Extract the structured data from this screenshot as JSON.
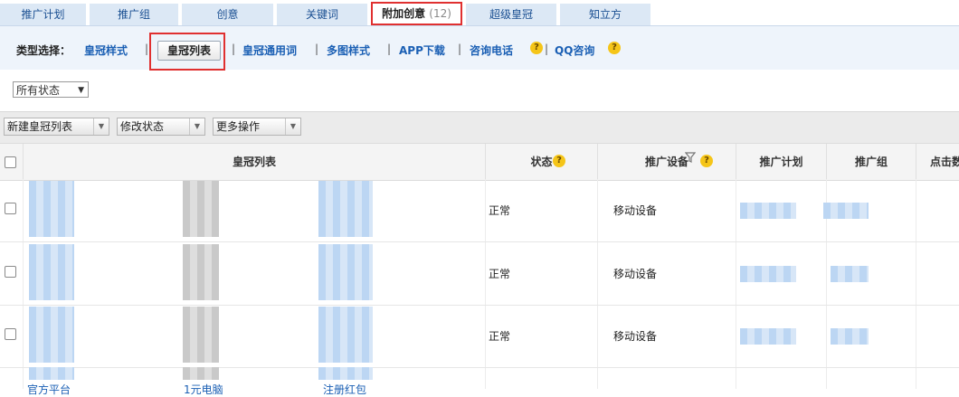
{
  "tabs": [
    {
      "label": "推广计划"
    },
    {
      "label": "推广组"
    },
    {
      "label": "创意"
    },
    {
      "label": "关键词"
    },
    {
      "label": "附加创意",
      "count": "(12)"
    },
    {
      "label": "超级皇冠"
    },
    {
      "label": "知立方"
    }
  ],
  "type_select": {
    "label": "类型选择：",
    "options": [
      "皇冠样式",
      "皇冠列表",
      "皇冠通用词",
      "多图样式",
      "APP下载",
      "咨询电话",
      "QQ咨询"
    ],
    "selected": "皇冠列表"
  },
  "status_filter": {
    "value": "所有状态"
  },
  "toolbar": {
    "new_list": "新建皇冠列表",
    "modify_status": "修改状态",
    "more_ops": "更多操作"
  },
  "table": {
    "headers": {
      "list": "皇冠列表",
      "status": "状态",
      "device": "推广设备",
      "plan": "推广计划",
      "group": "推广组",
      "clicks": "点击数"
    },
    "rows": [
      {
        "status": "正常",
        "device": "移动设备"
      },
      {
        "status": "正常",
        "device": "移动设备"
      },
      {
        "status": "正常",
        "device": "移动设备"
      }
    ],
    "partial_row_links": [
      "官方平台",
      "1元电脑",
      "注册红包"
    ]
  },
  "icons": {
    "help": "help-icon",
    "filter": "filter-icon"
  },
  "colors": {
    "link": "#1a5fb4",
    "highlight": "#e03030",
    "tab_bg": "#dce8f5"
  }
}
